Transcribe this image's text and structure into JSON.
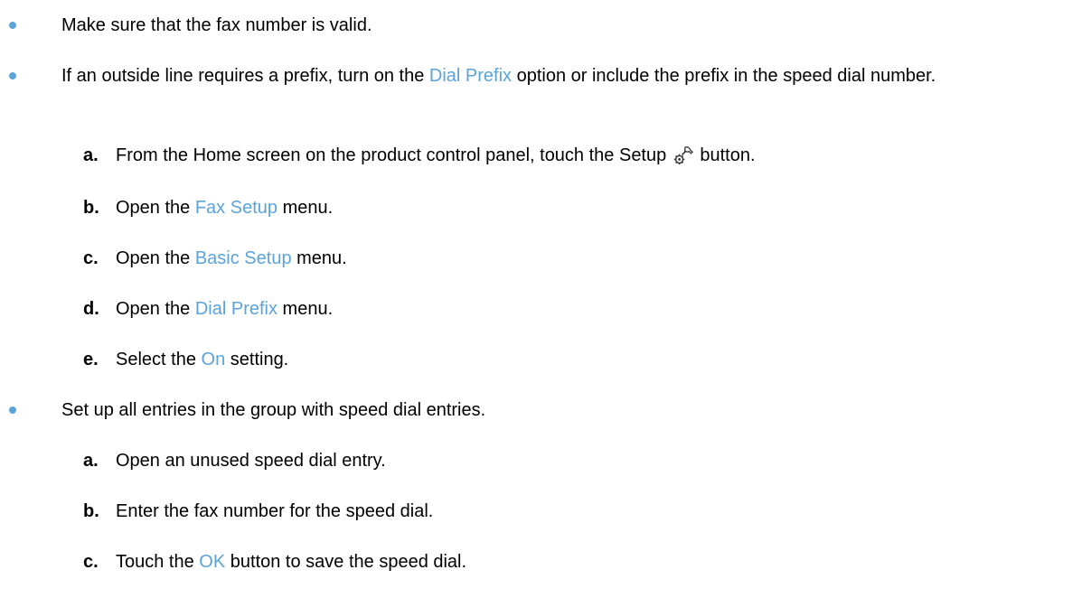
{
  "bullets": [
    {
      "text": "Make sure that the fax number is valid."
    },
    {
      "before": "If an outside line requires a prefix, turn on the ",
      "term": "Dial Prefix",
      "after": " option or include the prefix in the speed dial number.",
      "steps": [
        {
          "letter": "a.",
          "before": "From the Home screen on the product control panel, touch the Setup ",
          "icon": "setup-wrench-gear-icon",
          "after": " button."
        },
        {
          "letter": "b.",
          "before": "Open the ",
          "term": "Fax Setup",
          "after": " menu."
        },
        {
          "letter": "c.",
          "before": "Open the ",
          "term": "Basic Setup",
          "after": " menu."
        },
        {
          "letter": "d.",
          "before": "Open the ",
          "term": "Dial Prefix",
          "after": " menu."
        },
        {
          "letter": "e.",
          "before": "Select the ",
          "term": "On",
          "after": " setting."
        }
      ]
    },
    {
      "text": "Set up all entries in the group with speed dial entries.",
      "steps": [
        {
          "letter": "a.",
          "text": "Open an unused speed dial entry."
        },
        {
          "letter": "b.",
          "text": "Enter the fax number for the speed dial."
        },
        {
          "letter": "c.",
          "before": "Touch the ",
          "term": "OK",
          "after": " button to save the speed dial."
        }
      ]
    }
  ],
  "colors": {
    "bullet": "#5ba3d9",
    "ui_term": "#5ba3d9",
    "text": "#000000"
  }
}
